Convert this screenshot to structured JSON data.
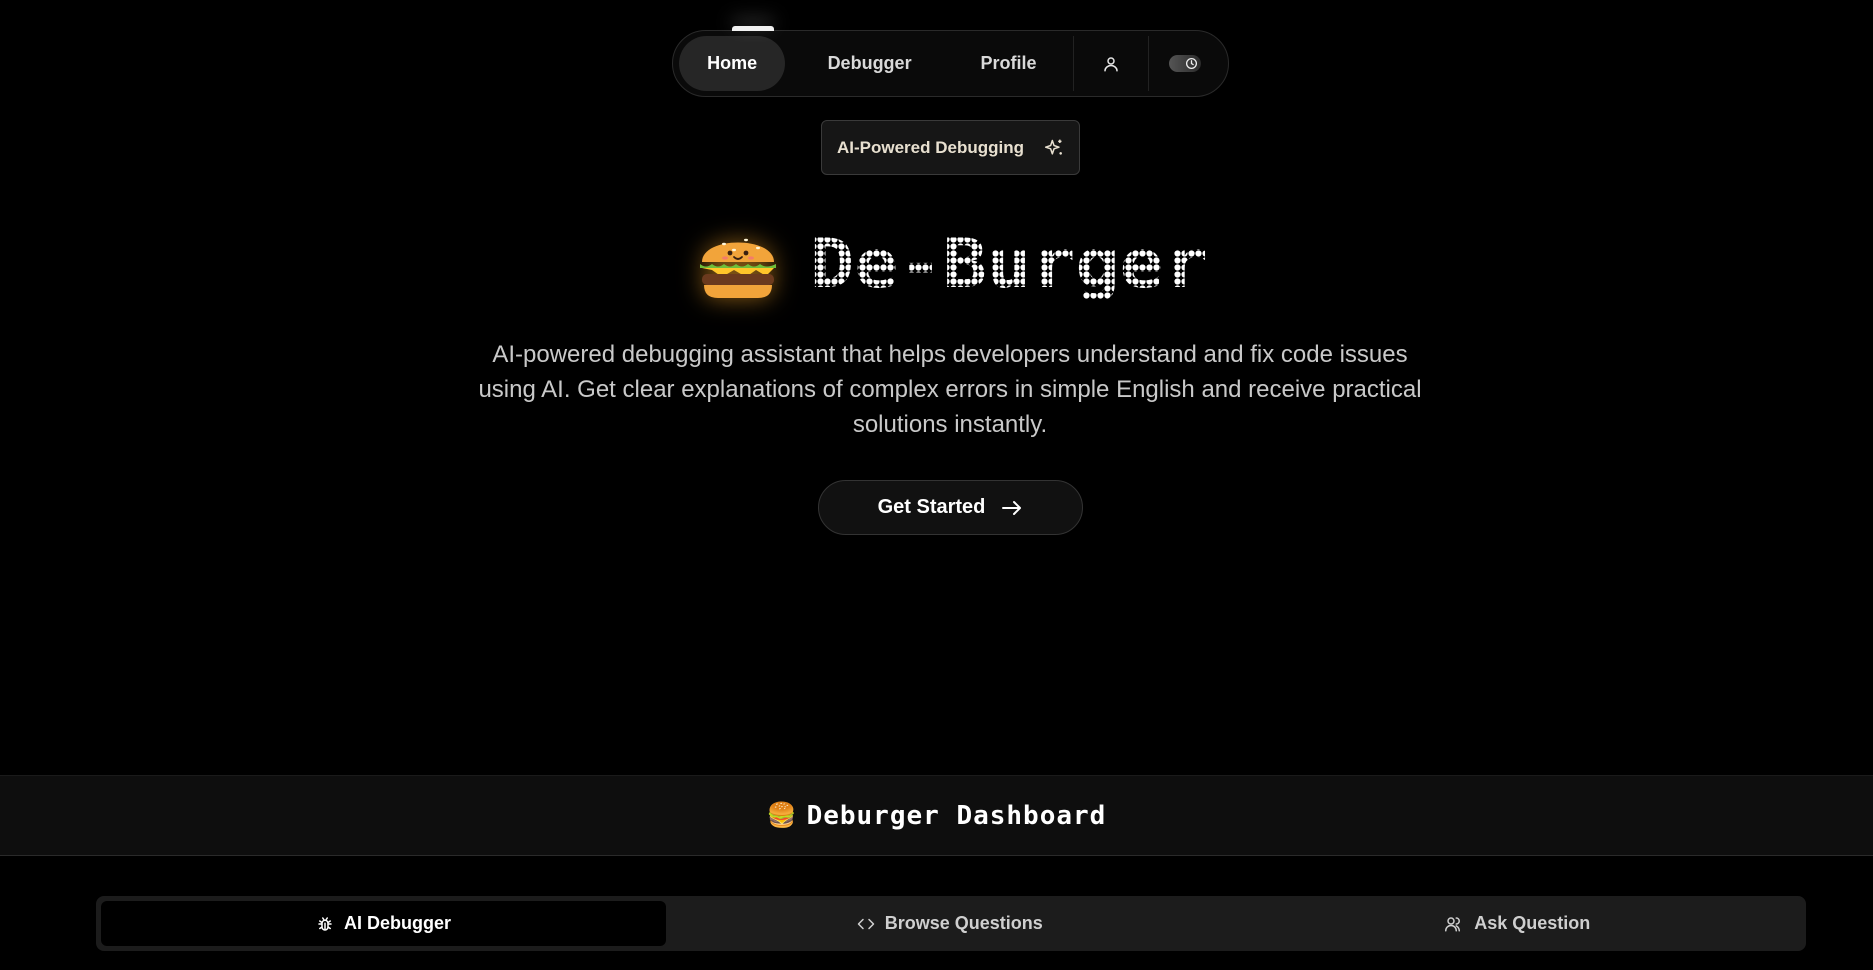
{
  "nav": {
    "items": [
      {
        "label": "Home",
        "active": true
      },
      {
        "label": "Debugger",
        "active": false
      },
      {
        "label": "Profile",
        "active": false
      }
    ],
    "icons": [
      "user-icon",
      "theme-toggle"
    ]
  },
  "badge": {
    "label": "AI-Powered Debugging",
    "icon": "sparkles-icon"
  },
  "hero": {
    "emoji": "🍔",
    "title": "De-Burger",
    "description": "AI-powered debugging assistant that helps developers understand and fix code issues using AI. Get clear explanations of complex errors in simple English and receive practical solutions instantly.",
    "cta_label": "Get Started",
    "cta_icon": "arrow-right-icon"
  },
  "dashboard": {
    "emoji": "🍔",
    "title": "Deburger Dashboard"
  },
  "tabs": [
    {
      "label": "AI Debugger",
      "icon": "bug-icon",
      "active": true
    },
    {
      "label": "Browse Questions",
      "icon": "code-icon",
      "active": false
    },
    {
      "label": "Ask Question",
      "icon": "users-icon",
      "active": false
    }
  ],
  "colors": {
    "background": "#000000",
    "surface": "#161616",
    "accent_glow": "#ffaa28"
  }
}
